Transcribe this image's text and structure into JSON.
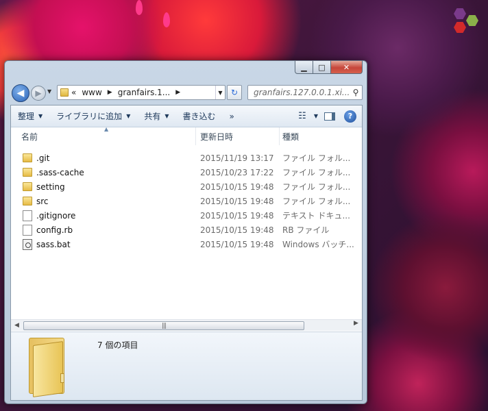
{
  "window": {
    "minimize": "▁",
    "maximize": "□",
    "close": "✕"
  },
  "nav": {
    "back": "◀",
    "forward": "▶",
    "history_dropdown": "▼"
  },
  "address": {
    "overflow": "«",
    "parts": [
      "www",
      "granfairs.1..."
    ],
    "refresh": "↻"
  },
  "search": {
    "text": "granfairs.127.0.0.1.xi...",
    "icon": "search-icon"
  },
  "toolbar": {
    "organize": "整理",
    "add_to_library": "ライブラリに追加",
    "share": "共有",
    "burn": "書き込む",
    "more": "»",
    "view_icon": "☷",
    "preview_icon": "preview-pane-icon",
    "help": "?"
  },
  "columns": {
    "name": "名前",
    "date": "更新日時",
    "type": "種類"
  },
  "files": [
    {
      "name": ".git",
      "date": "2015/11/19 13:17",
      "type": "ファイル フォル...",
      "icon": "folder"
    },
    {
      "name": ".sass-cache",
      "date": "2015/10/23 17:22",
      "type": "ファイル フォル...",
      "icon": "folder"
    },
    {
      "name": "setting",
      "date": "2015/10/15 19:48",
      "type": "ファイル フォル...",
      "icon": "folder"
    },
    {
      "name": "src",
      "date": "2015/10/15 19:48",
      "type": "ファイル フォル...",
      "icon": "folder"
    },
    {
      "name": ".gitignore",
      "date": "2015/10/15 19:48",
      "type": "テキスト ドキュ...",
      "icon": "file"
    },
    {
      "name": "config.rb",
      "date": "2015/10/15 19:48",
      "type": "RB ファイル",
      "icon": "file"
    },
    {
      "name": "sass.bat",
      "date": "2015/10/15 19:48",
      "type": "Windows バッチ...",
      "icon": "bat"
    }
  ],
  "scroll": {
    "left": "◀",
    "right": "▶",
    "grip": "|||"
  },
  "details": {
    "item_count": "7 個の項目"
  },
  "colors": {
    "accent": "#1e395b",
    "close_button": "#c6463a"
  }
}
